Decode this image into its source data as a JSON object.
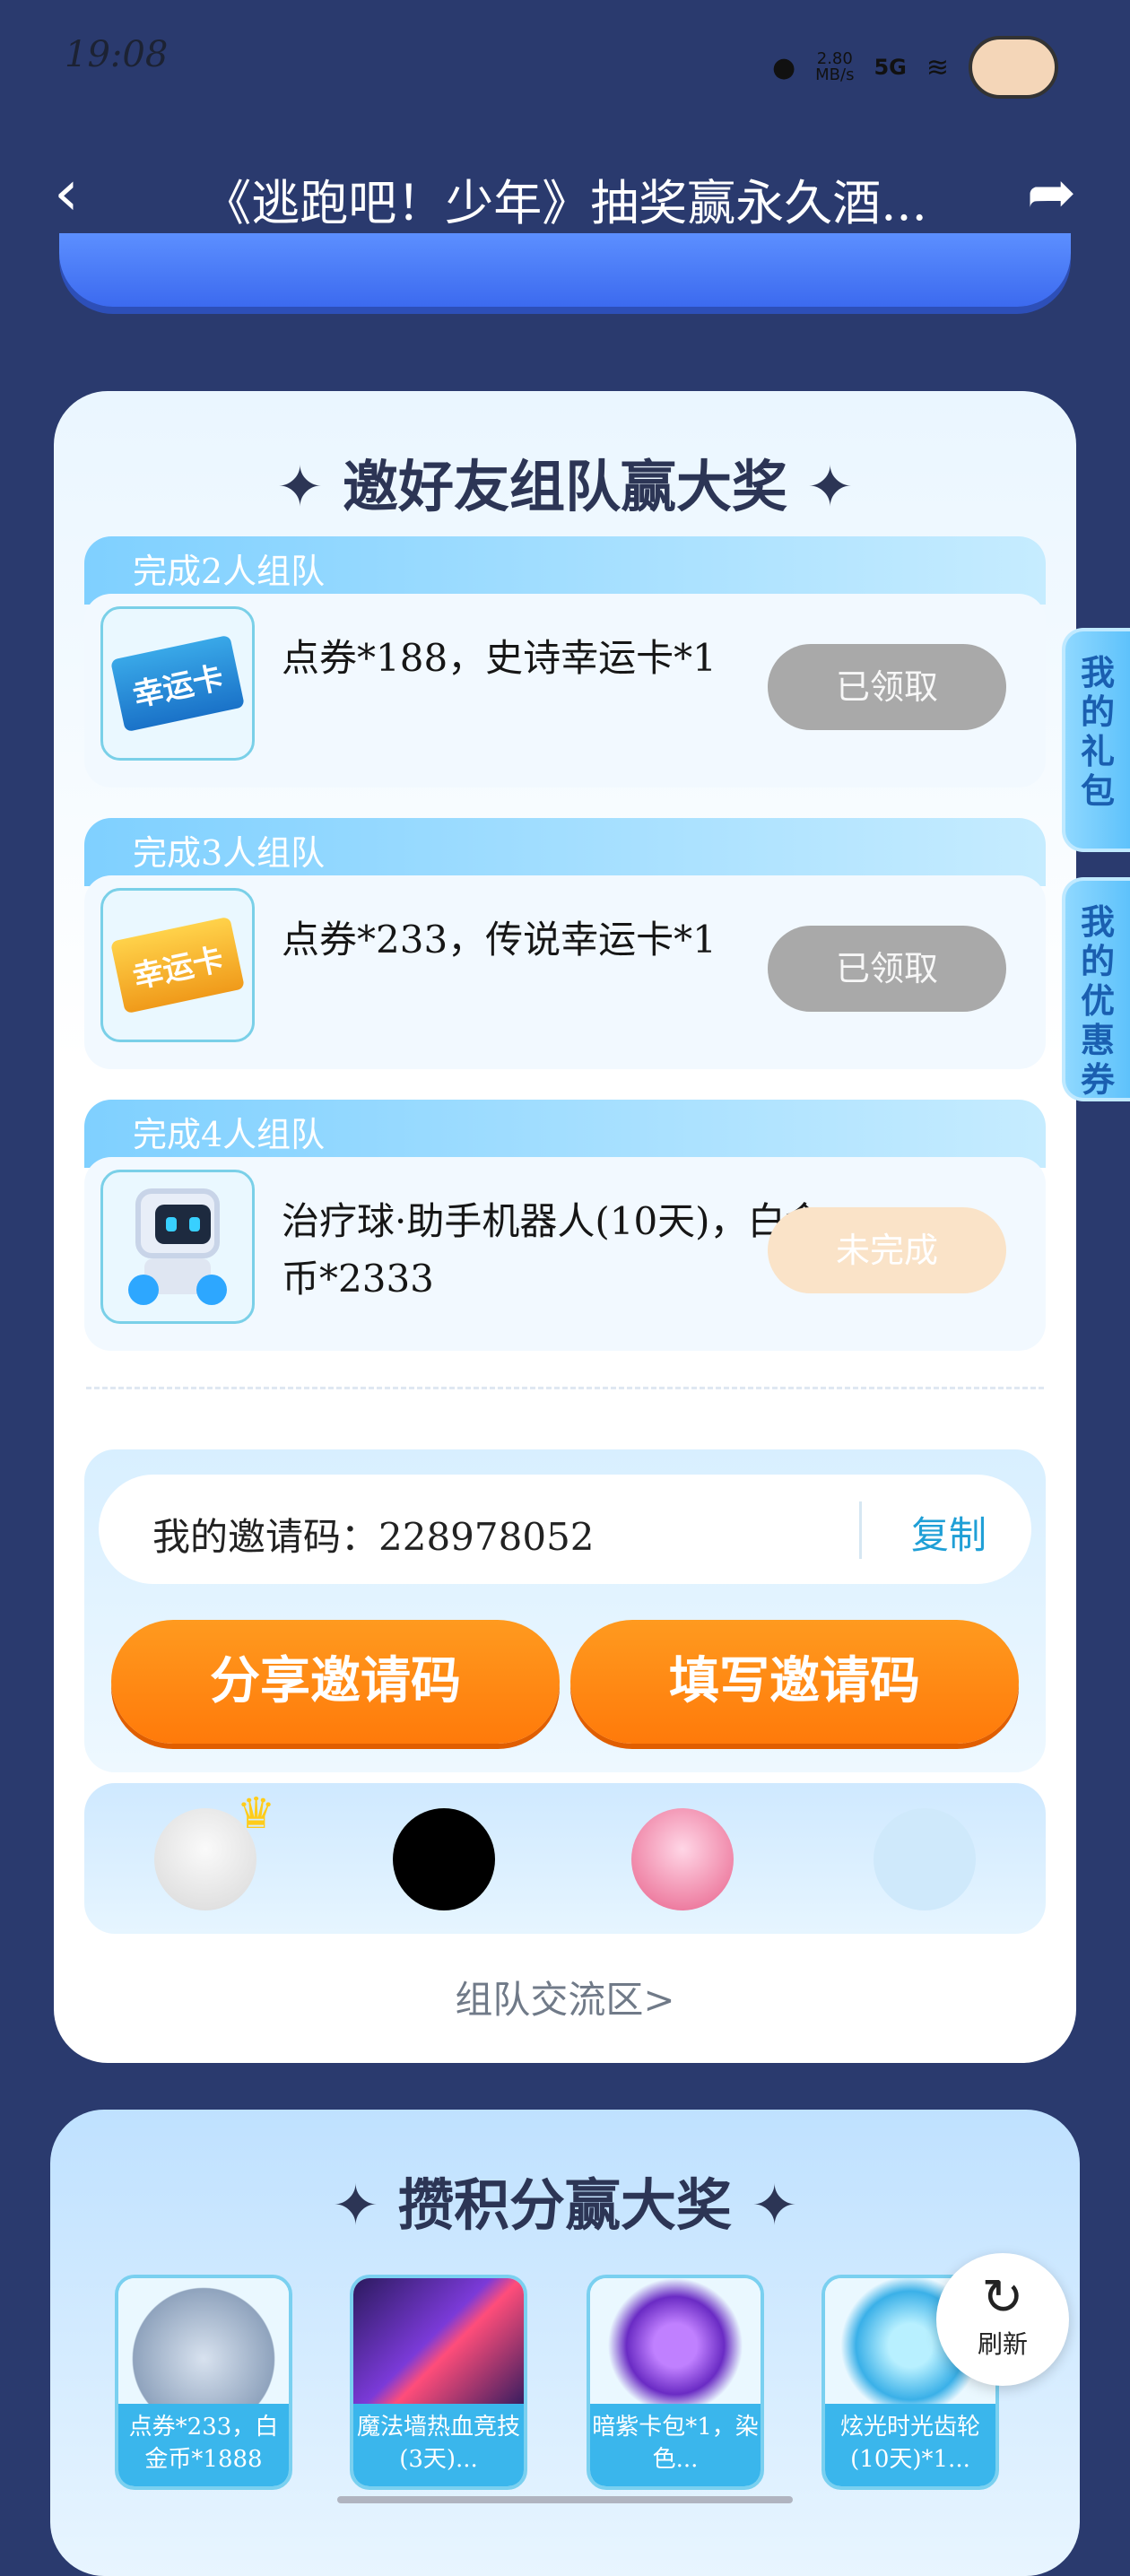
{
  "status_bar": {
    "time": "19:08",
    "net_speed_top": "2.80",
    "net_speed_bottom": "MB/s",
    "network": "5G"
  },
  "header": {
    "back_icon": "chevron-left-icon",
    "title": "《逃跑吧！少年》抽奖赢永久酒...",
    "share_icon": "share-icon"
  },
  "team_section": {
    "title": "邀好友组队赢大奖",
    "tiers": [
      {
        "tab": "完成2人组队",
        "reward": "点券*188，史诗幸运卡*1",
        "ticket_text": "幸运卡",
        "status": "已领取"
      },
      {
        "tab": "完成3人组队",
        "reward": "点券*233，传说幸运卡*1",
        "ticket_text": "幸运卡",
        "status": "已领取"
      },
      {
        "tab": "完成4人组队",
        "reward": "治疗球·助手机器人(10天)，白金币*2333",
        "status": "未完成"
      }
    ],
    "invite_code_label": "我的邀请码：",
    "invite_code": "228978052",
    "copy_label": "复制",
    "share_code_button": "分享邀请码",
    "fill_code_button": "填写邀请码",
    "team_link": "组队交流区>"
  },
  "side_tabs": {
    "gift": "我的礼包",
    "coupon": "我的优惠券"
  },
  "points_section": {
    "title": "攒积分赢大奖",
    "prizes": [
      {
        "label": "点券*233，白金币*1888"
      },
      {
        "label": "魔法墙热血竞技(3天)..."
      },
      {
        "label": "暗紫卡包*1，染色..."
      },
      {
        "label": "炫光时光齿轮(10天)*1..."
      }
    ]
  },
  "refresh": {
    "label": "刷新"
  },
  "colors": {
    "background": "#2a3a6e",
    "accent_orange": "#ff8a14",
    "claimed_gray": "#a9a9a9",
    "link_blue": "#1f9fd6"
  }
}
